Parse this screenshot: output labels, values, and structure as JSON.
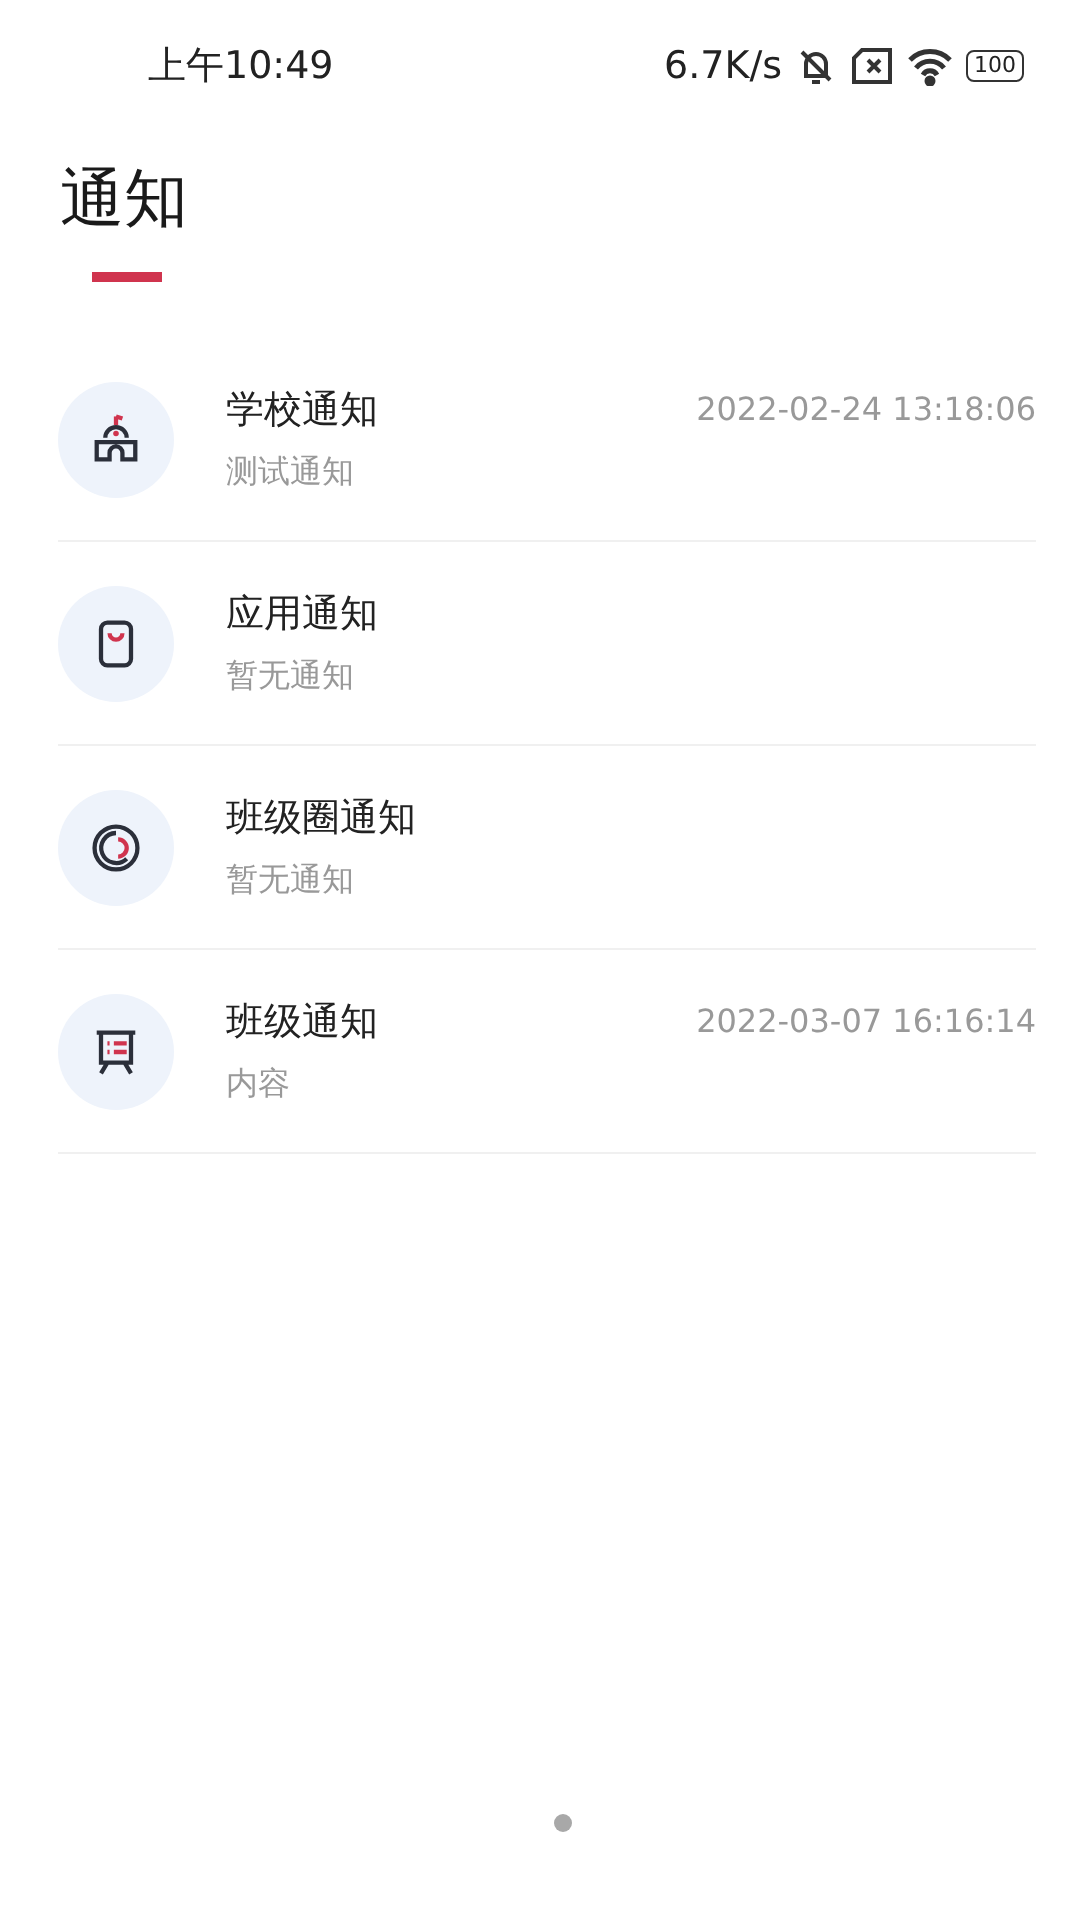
{
  "status_bar": {
    "time": "上午10:49",
    "speed": "6.7K/s",
    "battery": "100"
  },
  "title": "通知",
  "notifications": [
    {
      "kind": "school",
      "title": "学校通知",
      "subtitle": "测试通知",
      "time": "2022-02-24 13:18:06"
    },
    {
      "kind": "app",
      "title": "应用通知",
      "subtitle": "暂无通知"
    },
    {
      "kind": "circle",
      "title": "班级圈通知",
      "subtitle": "暂无通知"
    },
    {
      "kind": "board",
      "title": "班级通知",
      "subtitle": "内容",
      "time": "2022-03-07 16:16:14"
    }
  ]
}
